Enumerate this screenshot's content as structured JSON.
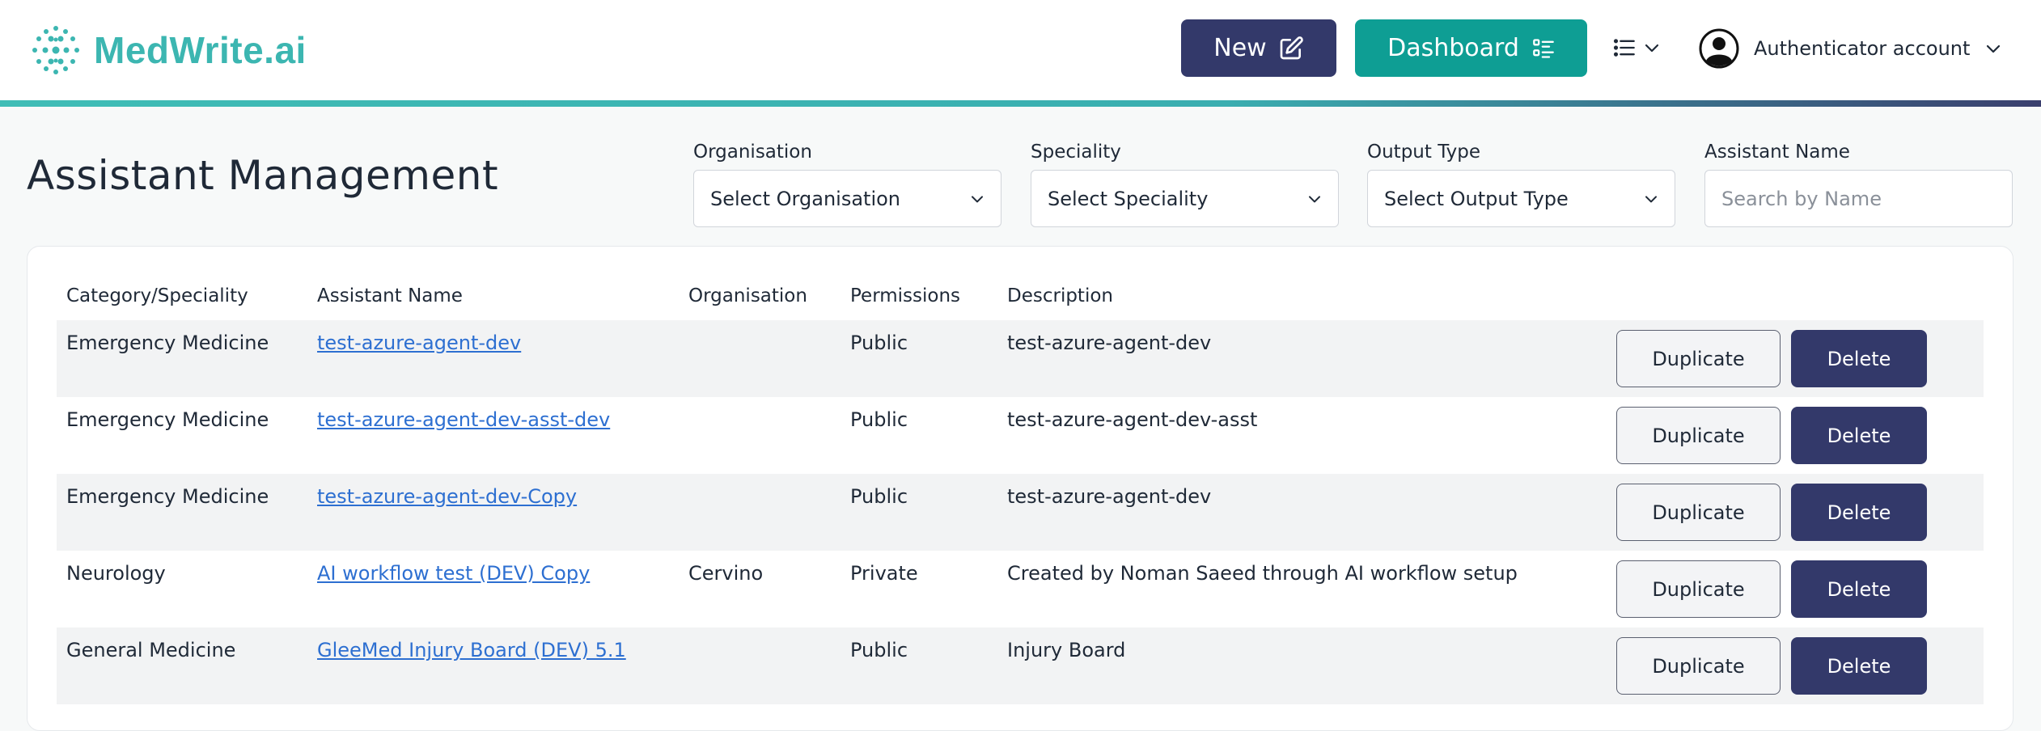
{
  "header": {
    "brand_name": "MedWrite.ai",
    "new_label": "New",
    "dashboard_label": "Dashboard",
    "account_label": "Authenticator account",
    "icons": [
      "logo-dots",
      "edit-icon",
      "dashboard-list-icon",
      "menu-list-icon",
      "chevron-down-icon",
      "user-circle-icon"
    ]
  },
  "page": {
    "title": "Assistant Management"
  },
  "filters": {
    "organisation": {
      "label": "Organisation",
      "value": "Select Organisation"
    },
    "speciality": {
      "label": "Speciality",
      "value": "Select Speciality"
    },
    "output_type": {
      "label": "Output Type",
      "value": "Select Output Type"
    },
    "assistant_name": {
      "label": "Assistant Name",
      "placeholder": "Search by Name"
    }
  },
  "table": {
    "columns": [
      "Category/Speciality",
      "Assistant Name",
      "Organisation",
      "Permissions",
      "Description"
    ],
    "duplicate_label": "Duplicate",
    "delete_label": "Delete",
    "rows": [
      {
        "category": "Emergency Medicine",
        "name": "test-azure-agent-dev",
        "organisation": "",
        "permissions": "Public",
        "description": "test-azure-agent-dev"
      },
      {
        "category": "Emergency Medicine",
        "name": "test-azure-agent-dev-asst-dev",
        "organisation": "",
        "permissions": "Public",
        "description": "test-azure-agent-dev-asst"
      },
      {
        "category": "Emergency Medicine",
        "name": "test-azure-agent-dev-Copy",
        "organisation": "",
        "permissions": "Public",
        "description": "test-azure-agent-dev"
      },
      {
        "category": "Neurology",
        "name": "AI workflow test (DEV) Copy",
        "organisation": "Cervino",
        "permissions": "Private",
        "description": "Created by Noman Saeed through AI workflow setup"
      },
      {
        "category": "General Medicine",
        "name": "GleeMed Injury Board (DEV) 5.1",
        "organisation": "",
        "permissions": "Public",
        "description": "Injury Board"
      }
    ]
  },
  "colors": {
    "brand_teal": "#3cb6b1",
    "navy": "#33396a",
    "dashboard_teal": "#0e9e94",
    "link_blue": "#2d6fd1",
    "row_shade": "#f2f3f4"
  }
}
